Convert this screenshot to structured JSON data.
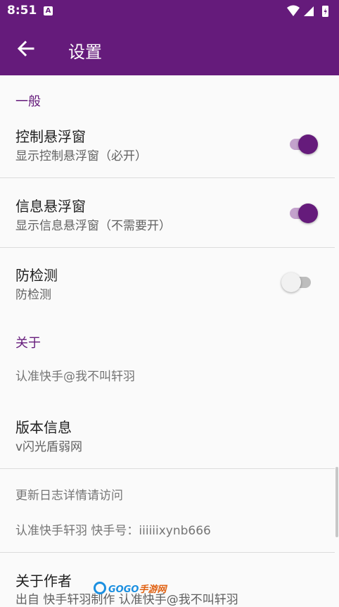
{
  "status_bar": {
    "time": "8:51",
    "notification_icon": "a-icon"
  },
  "app_bar": {
    "title": "设置",
    "back_icon": "arrow-left-icon"
  },
  "colors": {
    "primary": "#651b7b",
    "switch_on_track": "#c3a2cc",
    "section_title": "#651b7b"
  },
  "general": {
    "section_title": "一般",
    "control_float": {
      "title": "控制悬浮窗",
      "summary": "显示控制悬浮窗（必开）",
      "enabled": true
    },
    "info_float": {
      "title": "信息悬浮窗",
      "summary": "显示信息悬浮窗（不需要开）",
      "enabled": true
    },
    "anti_detect": {
      "title": "防检测",
      "summary": "防检测",
      "enabled": false
    }
  },
  "about": {
    "section_title": "关于",
    "notice": "认准快手@我不叫轩羽",
    "version": {
      "title": "版本信息",
      "summary": "v闪光盾弱网"
    },
    "changelog_hint": "更新日志详情请访问",
    "kuaishou_id": "认准快手轩羽 快手号：iiiiiixynb666",
    "author": {
      "title": "关于作者",
      "summary": "出自 快手轩羽制作 认准快手@我不叫轩羽"
    }
  },
  "watermark": {
    "text_a": "GOGO",
    "text_b": "手游网"
  }
}
